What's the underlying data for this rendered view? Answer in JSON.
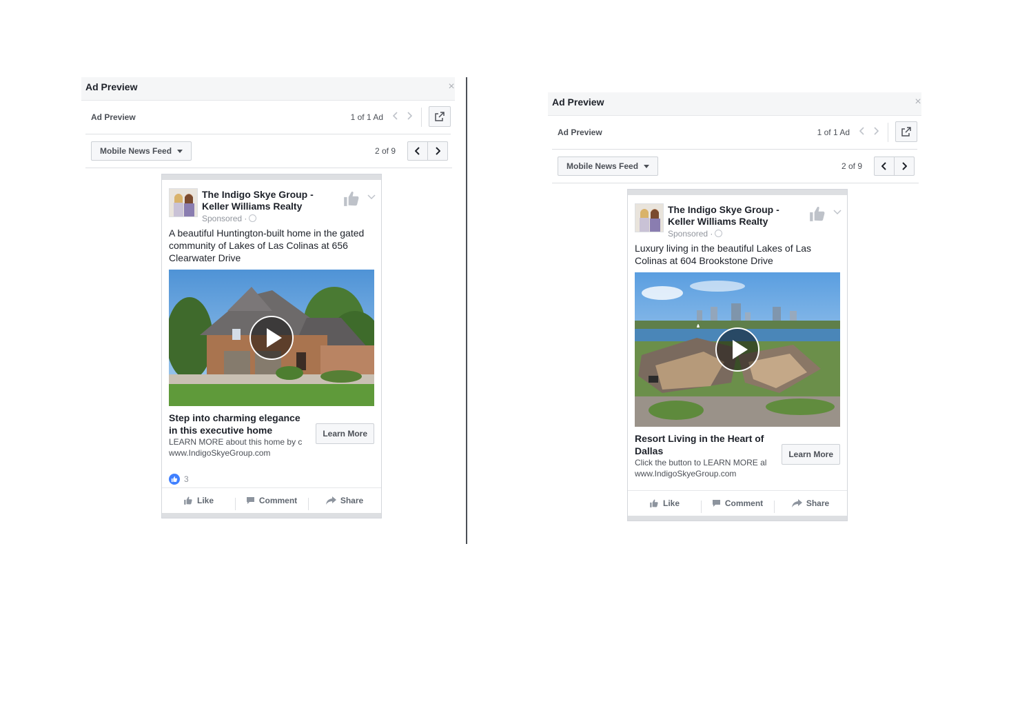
{
  "panels": [
    {
      "header_title": "Ad Preview",
      "close_glyph": "×",
      "ad_label": "Ad Preview",
      "ad_count": "1 of 1 Ad",
      "placement": "Mobile News Feed",
      "placement_count": "2 of 9",
      "post": {
        "page_name": "The Indigo Skye Group - Keller Williams Realty",
        "sponsored": "Sponsored ·",
        "text": "A beautiful Huntington-built home in the gated community of Lakes of Las Colinas at 656 Clearwater Drive",
        "link_title": "Step into charming elegance in this executive home",
        "link_desc": "LEARN MORE about this home by c",
        "link_url": "www.IndigoSkyeGroup.com",
        "cta": "Learn More",
        "reaction_count": "3",
        "actions": [
          "Like",
          "Comment",
          "Share"
        ]
      }
    },
    {
      "header_title": "Ad Preview",
      "close_glyph": "×",
      "ad_label": "Ad Preview",
      "ad_count": "1 of 1 Ad",
      "placement": "Mobile News Feed",
      "placement_count": "2 of 9",
      "post": {
        "page_name": "The Indigo Skye Group - Keller Williams Realty",
        "sponsored": "Sponsored ·",
        "text": "Luxury living in the beautiful Lakes of Las Colinas at 604 Brookstone Drive",
        "link_title": "Resort Living in the Heart of Dallas",
        "link_desc": "Click the button to LEARN MORE al",
        "link_url": "www.IndigoSkyeGroup.com",
        "cta": "Learn More",
        "actions": [
          "Like",
          "Comment",
          "Share"
        ]
      }
    }
  ],
  "icons": {
    "close": "close-icon",
    "prev": "chevron-left-icon",
    "next": "chevron-right-icon",
    "external": "external-link-icon",
    "like": "thumbs-up-icon",
    "comment": "comment-icon",
    "share": "share-icon",
    "globe": "globe-icon",
    "menu": "chevron-down-icon",
    "play": "play-icon"
  },
  "colors": {
    "header_bg": "#f5f6f7",
    "text": "#1d2129",
    "muted": "#90949c",
    "like_blue": "#4080ff",
    "button_bg": "#f6f7f9",
    "border": "#ccd0d5"
  }
}
